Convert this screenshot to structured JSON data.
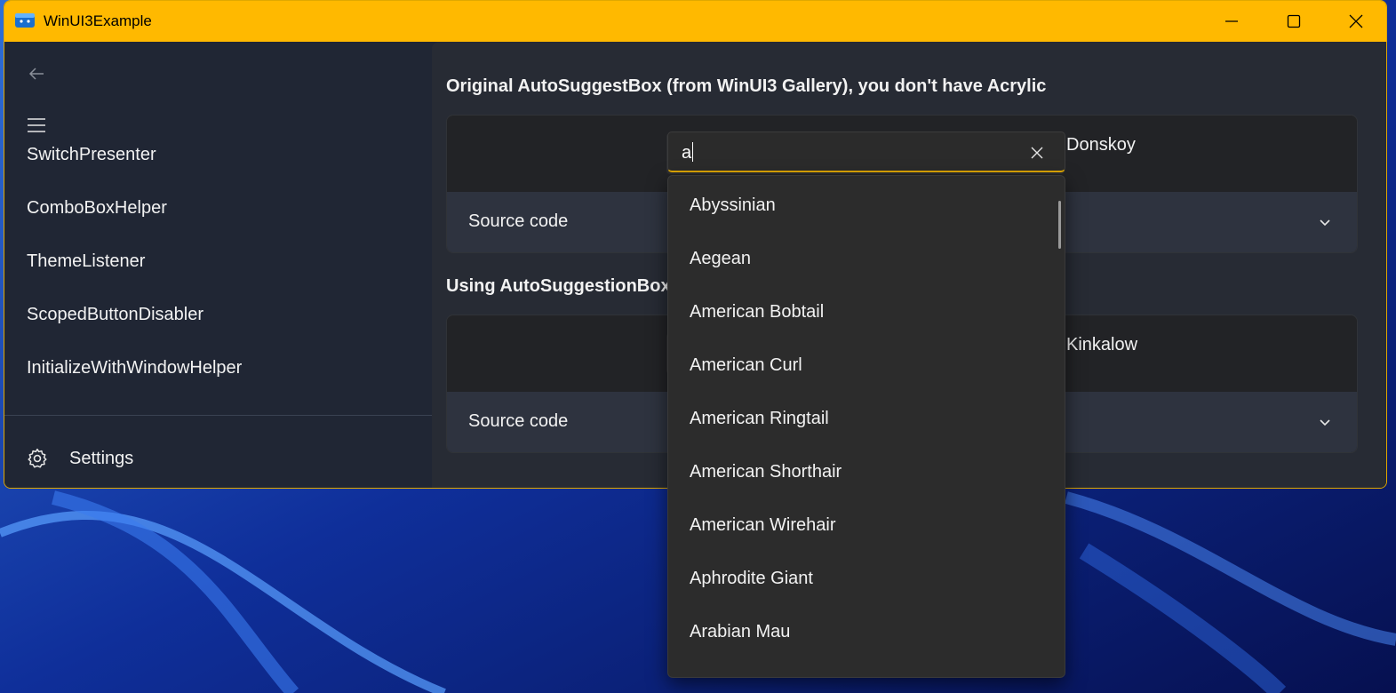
{
  "window": {
    "title": "WinUI3Example"
  },
  "colors": {
    "accent": "#ffb900",
    "nav_bg": "#202634",
    "content_bg": "#272b34",
    "dropdown_bg": "#2c2c2c"
  },
  "icons": {
    "app": "app-icon",
    "minimize": "minimize-icon",
    "maximize": "maximize-icon",
    "close": "close-icon",
    "back": "back-arrow-icon",
    "menu": "hamburger-icon",
    "settings": "gear-icon",
    "chevron": "chevron-down-icon",
    "clear": "clear-icon"
  },
  "nav": {
    "items": [
      {
        "label": "SwitchPresenter"
      },
      {
        "label": "ComboBoxHelper"
      },
      {
        "label": "ThemeListener"
      },
      {
        "label": "ScopedButtonDisabler"
      },
      {
        "label": "InitializeWithWindowHelper"
      }
    ],
    "settings_label": "Settings"
  },
  "sections": [
    {
      "title": "Original AutoSuggestBox (from WinUI3 Gallery), you don't have Acrylic",
      "selected": "Donskoy",
      "source_label": "Source code"
    },
    {
      "title": "Using AutoSuggestionBox",
      "selected": "Kinkalow",
      "source_label": "Source code"
    }
  ],
  "search": {
    "value": "a",
    "suggestions": [
      "Abyssinian",
      "Aegean",
      "American Bobtail",
      "American Curl",
      "American Ringtail",
      "American Shorthair",
      "American Wirehair",
      "Aphrodite Giant",
      "Arabian Mau"
    ]
  }
}
